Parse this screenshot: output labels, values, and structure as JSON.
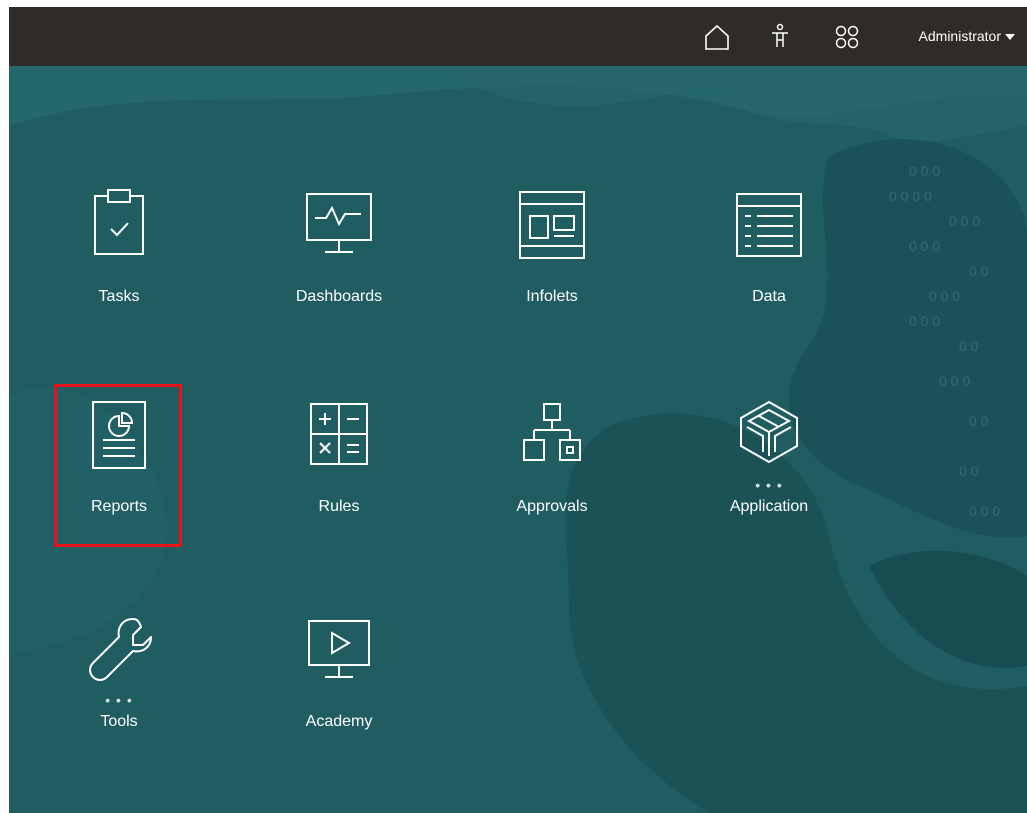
{
  "header": {
    "user_label": "Administrator",
    "icons": [
      "home-icon",
      "accessibility-icon",
      "navigator-icon"
    ]
  },
  "tiles": [
    {
      "label": "Tasks",
      "icon": "clipboard-check-icon"
    },
    {
      "label": "Dashboards",
      "icon": "monitor-pulse-icon"
    },
    {
      "label": "Infolets",
      "icon": "infolet-panel-icon"
    },
    {
      "label": "Data",
      "icon": "data-grid-icon"
    },
    {
      "label": "Reports",
      "icon": "report-chart-icon",
      "highlighted": true
    },
    {
      "label": "Rules",
      "icon": "calculator-icon"
    },
    {
      "label": "Approvals",
      "icon": "hierarchy-icon"
    },
    {
      "label": "Application",
      "icon": "cube-icon",
      "more": true
    },
    {
      "label": "Tools",
      "icon": "wrench-icon",
      "more": true
    },
    {
      "label": "Academy",
      "icon": "play-monitor-icon"
    }
  ],
  "colors": {
    "header_bg": "#2f2b28",
    "content_bg": "#1f5d61",
    "highlight_border": "#e8121b"
  }
}
